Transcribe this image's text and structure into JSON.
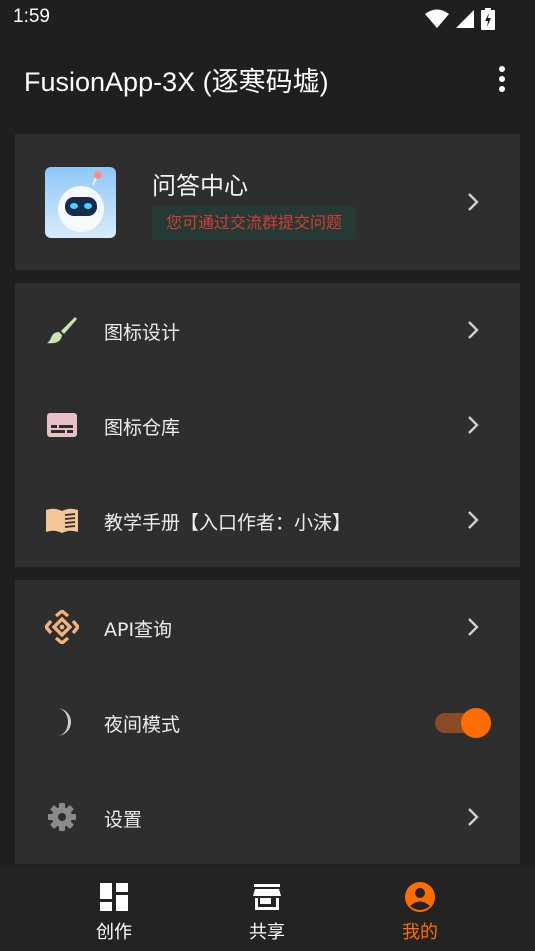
{
  "status_bar": {
    "time": "1:59"
  },
  "app_bar": {
    "title": "FusionApp-3X (逐寒码墟)"
  },
  "qa_card": {
    "title": "问答中心",
    "badge": "您可通过交流群提交问题"
  },
  "tools": [
    {
      "label": "图标设计",
      "icon": "paintbrush-icon"
    },
    {
      "label": "图标仓库",
      "icon": "subtitles-icon"
    },
    {
      "label": "教学手册【入口作者：小沫】",
      "icon": "book-icon"
    }
  ],
  "settings": [
    {
      "label": "API查询",
      "icon": "api-icon"
    },
    {
      "label": "夜间模式",
      "icon": "moon-icon",
      "toggle_on": true
    },
    {
      "label": "设置",
      "icon": "gear-icon"
    }
  ],
  "bottom_nav": {
    "items": [
      {
        "label": "创作",
        "icon": "dashboard-icon",
        "active": false
      },
      {
        "label": "共享",
        "icon": "store-icon",
        "active": false
      },
      {
        "label": "我的",
        "icon": "account-icon",
        "active": true
      }
    ],
    "active_color": "#ff6d00",
    "inactive_color": "#ffffff"
  },
  "colors": {
    "accent": "#ff6d00",
    "background": "#1f1f1f",
    "card": "#2e2e2e",
    "badge_text": "#d83a34"
  }
}
